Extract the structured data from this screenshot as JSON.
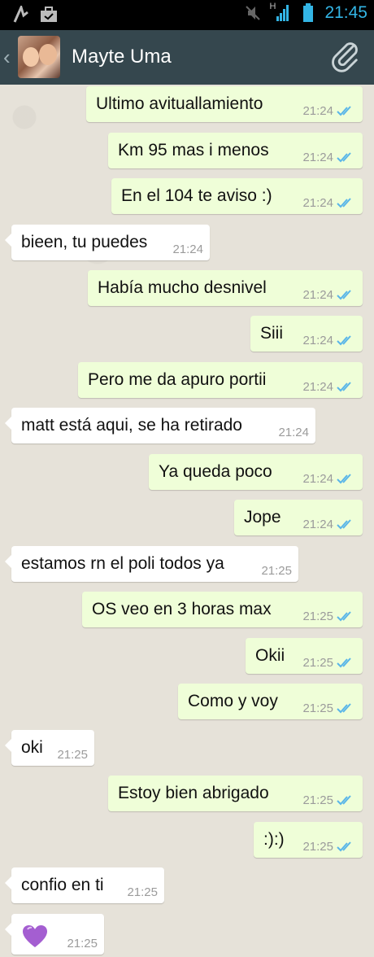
{
  "status_bar": {
    "time": "21:45",
    "network_label": "H",
    "icons": [
      "signal-activity-icon",
      "briefcase-icon",
      "mute-icon",
      "cell-signal-icon",
      "battery-icon"
    ]
  },
  "header": {
    "contact_name": "Mayte Uma",
    "back_icon": "chevron-left-icon",
    "attach_icon": "paperclip-icon"
  },
  "colors": {
    "status_accent": "#33b5e5",
    "header_bg": "#35474e",
    "outgoing_bubble": "#effed8",
    "incoming_bubble": "#ffffff",
    "read_ticks": "#5ab6e8"
  },
  "messages": [
    {
      "direction": "out",
      "text": "Ultimo avituallamiento",
      "time": "21:24",
      "status": "read"
    },
    {
      "direction": "out",
      "text": "Km 95 mas i menos",
      "time": "21:24",
      "status": "read"
    },
    {
      "direction": "out",
      "text": "En el 104 te aviso :)",
      "time": "21:24",
      "status": "read"
    },
    {
      "direction": "in",
      "text": "bieen, tu puedes",
      "time": "21:24"
    },
    {
      "direction": "out",
      "text": "Había mucho desnivel",
      "time": "21:24",
      "status": "read"
    },
    {
      "direction": "out",
      "text": "Siii",
      "time": "21:24",
      "status": "read"
    },
    {
      "direction": "out",
      "text": "Pero me da apuro portii",
      "time": "21:24",
      "status": "read"
    },
    {
      "direction": "in",
      "text": "matt está aqui, se ha retirado",
      "time": "21:24"
    },
    {
      "direction": "out",
      "text": "Ya queda poco",
      "time": "21:24",
      "status": "read"
    },
    {
      "direction": "out",
      "text": "Jope",
      "time": "21:24",
      "status": "read"
    },
    {
      "direction": "in",
      "text": "estamos rn el poli todos ya",
      "time": "21:25"
    },
    {
      "direction": "out",
      "text": "OS veo en 3 horas max",
      "time": "21:25",
      "status": "read"
    },
    {
      "direction": "out",
      "text": "Okii",
      "time": "21:25",
      "status": "read"
    },
    {
      "direction": "out",
      "text": "Como y voy",
      "time": "21:25",
      "status": "read"
    },
    {
      "direction": "in",
      "text": "oki",
      "time": "21:25"
    },
    {
      "direction": "out",
      "text": "Estoy bien abrigado",
      "time": "21:25",
      "status": "read"
    },
    {
      "direction": "out",
      "text": ":):)",
      "time": "21:25",
      "status": "read"
    },
    {
      "direction": "in",
      "text": "confio en ti",
      "time": "21:25"
    },
    {
      "direction": "in",
      "text": "",
      "emoji_icon": "purple-heart-icon",
      "time": "21:25"
    }
  ]
}
